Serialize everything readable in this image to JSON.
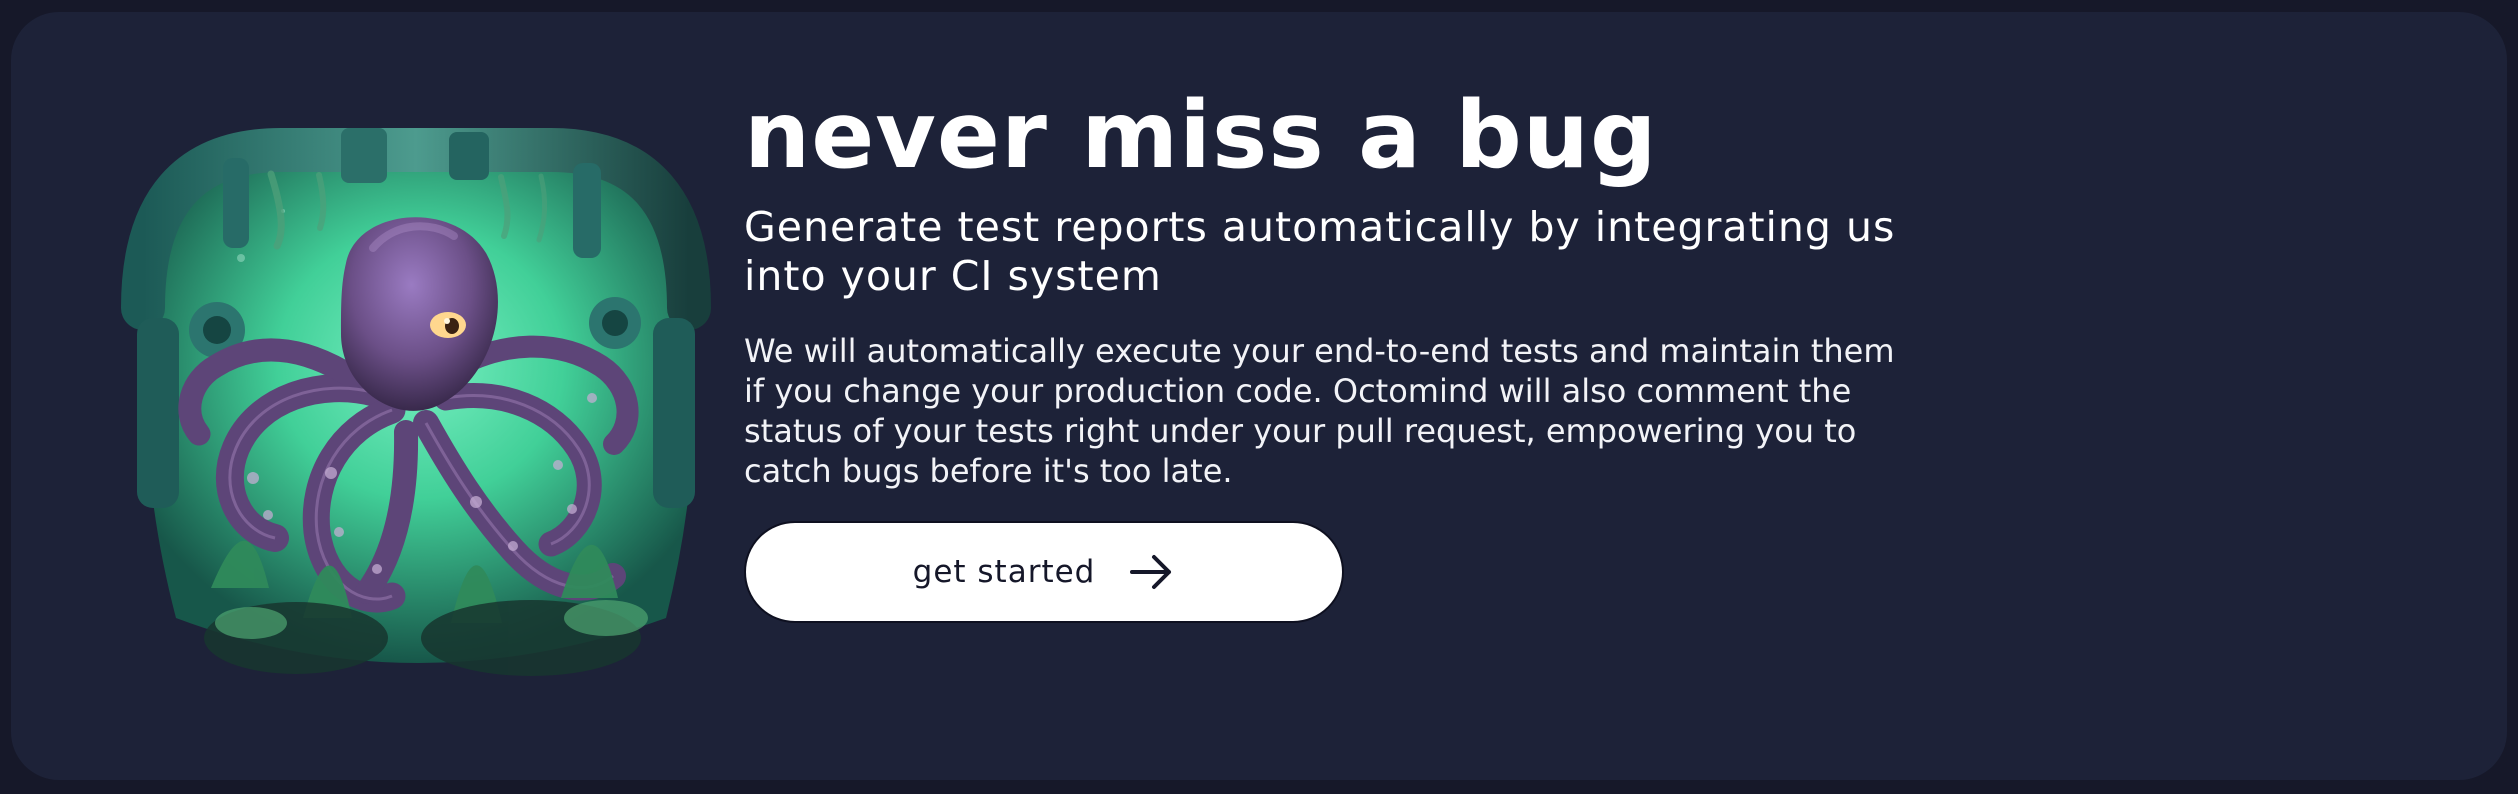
{
  "hero": {
    "headline": "never miss a bug",
    "subheadline": "Generate test reports automatically by integrating us into your CI system",
    "description": "We will automatically execute your end-to-end tests and maintain them if you change your production code. Octomind will also comment the status of your tests right under your pull request, empowering you to catch bugs before it's too late.",
    "cta": {
      "label": "get started",
      "icon": "arrow-right-icon"
    },
    "illustration": {
      "subject": "octopus-illustration"
    }
  },
  "colors": {
    "page_background": "#161829",
    "card_background": "#1d2238",
    "text_primary": "#ffffff",
    "button_background": "#ffffff",
    "button_text": "#151729",
    "illustration_glow": "#4fe3a7",
    "octopus": "#6b4f87"
  }
}
